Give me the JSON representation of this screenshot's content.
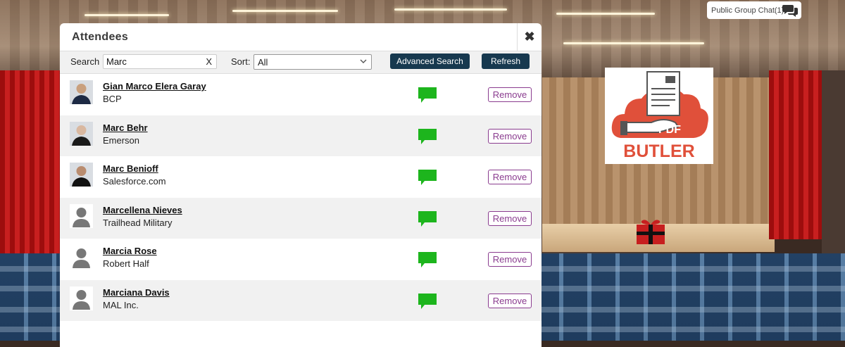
{
  "public_chat": {
    "label": "Public Group Chat(1)"
  },
  "logo": {
    "line1": "PDF",
    "line2": "BUTLER"
  },
  "modal": {
    "title": "Attendees",
    "close_label": "✖",
    "search_label": "Search",
    "search_value": "Marc",
    "clear_label": "X",
    "sort_label": "Sort:",
    "sort_value": "All",
    "advanced_search_label": "Advanced Search",
    "refresh_label": "Refresh",
    "remove_label": "Remove",
    "attendees": [
      {
        "name": "Gian Marco Elera Garay",
        "company": "BCP",
        "photo": "photo"
      },
      {
        "name": "Marc Behr",
        "company": "Emerson",
        "photo": "photo"
      },
      {
        "name": "Marc Benioff",
        "company": "Salesforce.com",
        "photo": "photo"
      },
      {
        "name": "Marcellena Nieves",
        "company": "Trailhead Military",
        "photo": "placeholder"
      },
      {
        "name": "Marcia Rose",
        "company": "Robert Half",
        "photo": "placeholder"
      },
      {
        "name": "Marciana Davis",
        "company": "MAL Inc.",
        "photo": "placeholder"
      }
    ]
  },
  "colors": {
    "chat_green": "#1db51d",
    "remove_purple": "#8a3c8f",
    "button_navy": "#17394f",
    "logo_orange": "#e0503a"
  }
}
